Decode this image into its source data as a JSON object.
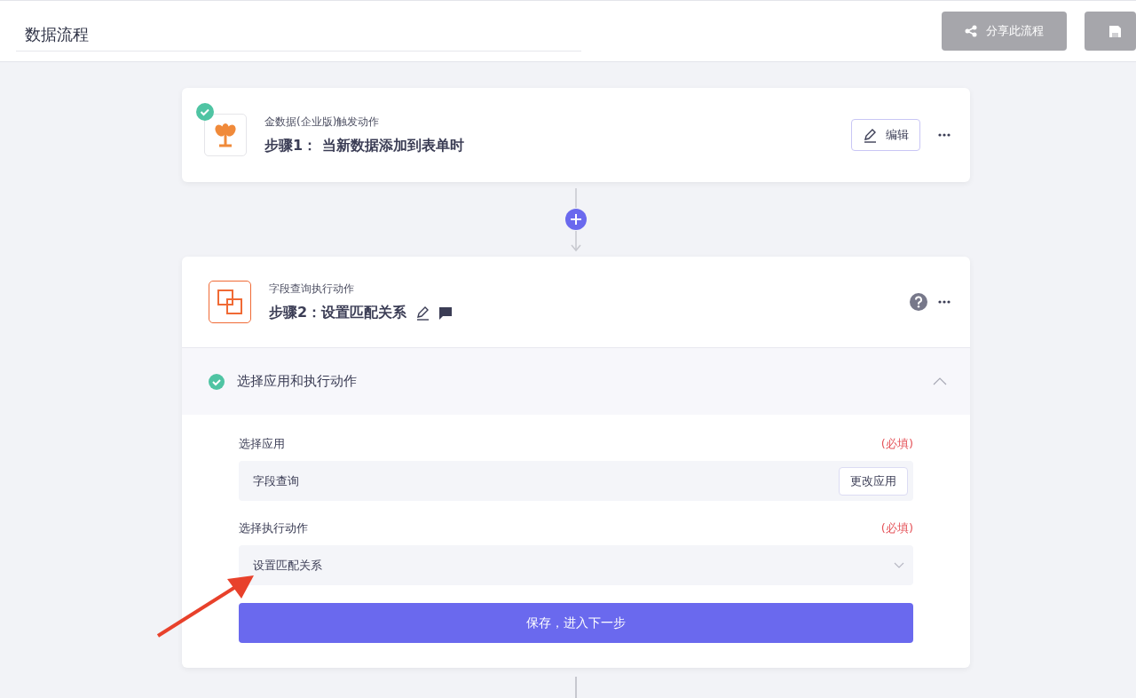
{
  "header": {
    "title": "数据流程",
    "buttons": [
      {
        "kind": "share",
        "label": "分享此流程",
        "disabled": true
      },
      {
        "kind": "save",
        "disabled": true
      }
    ]
  },
  "steps": [
    {
      "kind": "trigger",
      "completed": true,
      "app": "金数据(企业版)触发动作",
      "title": "步骤1： 当新数据添加到表单时",
      "edit_label": "编辑"
    },
    {
      "kind": "action",
      "app": "字段查询执行动作",
      "title": "步骤2：设置匹配关系",
      "section": {
        "title": "选择应用和执行动作",
        "completed": true,
        "expanded": true,
        "fields": [
          {
            "kind": "app",
            "label": "选择应用",
            "required": "(必填)",
            "value": "字段查询",
            "button": "更改应用"
          },
          {
            "kind": "select",
            "label": "选择执行动作",
            "required": "(必填)",
            "value": "设置匹配关系"
          }
        ],
        "submit": "保存，进入下一步"
      }
    }
  ]
}
